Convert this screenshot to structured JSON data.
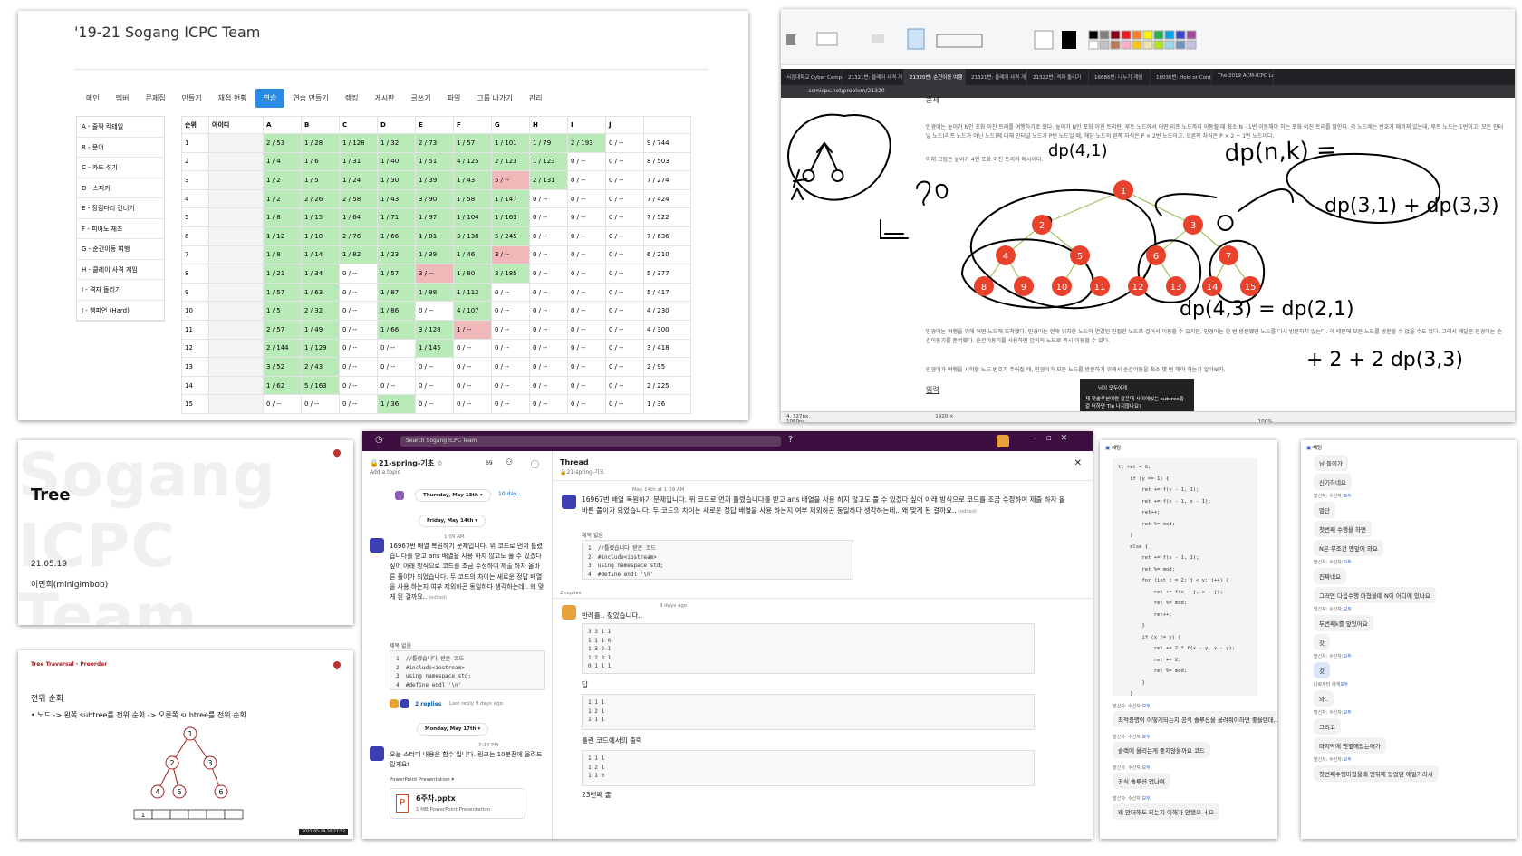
{
  "icpc": {
    "title": "'19-21 Sogang ICPC Team",
    "nav": [
      "메인",
      "멤버",
      "문제집",
      "만들기",
      "채점 현황",
      "연습",
      "연습 만들기",
      "랭킹",
      "게시판",
      "글쓰기",
      "파일",
      "그룹 나가기",
      "관리"
    ],
    "problems": [
      "A - 줄짝 칵테일",
      "B - 문어",
      "C - 카드 섞기",
      "D - 스피카",
      "E - 징검다리 건너기",
      "F - 피아노 체조",
      "G - 순간이동 여행",
      "H - 클레이 사격 게임",
      "I - 격자 돌리기",
      "J - 챔피언 (Hard)"
    ],
    "headers": [
      "순위",
      "아이디",
      "A",
      "B",
      "C",
      "D",
      "E",
      "F",
      "G",
      "H",
      "I",
      "J",
      ""
    ],
    "rows": [
      [
        "1",
        "2 / 53",
        "1 / 28",
        "1 / 128",
        "1 / 32",
        "2 / 73",
        "1 / 57",
        "1 / 101",
        "1 / 79",
        "2 / 193",
        "0 / --",
        "9 / 744"
      ],
      [
        "2",
        "1 / 4",
        "1 / 6",
        "1 / 31",
        "1 / 40",
        "1 / 51",
        "4 / 125",
        "2 / 123",
        "1 / 123",
        "0 / --",
        "0 / --",
        "8 / 503"
      ],
      [
        "3",
        "1 / 2",
        "1 / 5",
        "1 / 24",
        "1 / 30",
        "1 / 39",
        "1 / 43",
        "5 / --",
        "2 / 131",
        "0 / --",
        "0 / --",
        "7 / 274"
      ],
      [
        "4",
        "1 / 2",
        "2 / 26",
        "2 / 58",
        "1 / 43",
        "3 / 90",
        "1 / 58",
        "1 / 147",
        "0 / --",
        "0 / --",
        "0 / --",
        "7 / 424"
      ],
      [
        "5",
        "1 / 8",
        "1 / 15",
        "1 / 64",
        "1 / 71",
        "1 / 97",
        "1 / 104",
        "1 / 163",
        "0 / --",
        "0 / --",
        "0 / --",
        "7 / 522"
      ],
      [
        "6",
        "1 / 12",
        "1 / 18",
        "2 / 76",
        "1 / 66",
        "1 / 81",
        "3 / 138",
        "5 / 245",
        "0 / --",
        "0 / --",
        "0 / --",
        "7 / 636"
      ],
      [
        "7",
        "1 / 8",
        "1 / 14",
        "1 / 82",
        "1 / 23",
        "1 / 39",
        "1 / 46",
        "3 / --",
        "0 / --",
        "0 / --",
        "0 / --",
        "6 / 210"
      ],
      [
        "8",
        "1 / 21",
        "1 / 34",
        "0 / --",
        "1 / 57",
        "3 / --",
        "1 / 80",
        "3 / 185",
        "0 / --",
        "0 / --",
        "0 / --",
        "5 / 377"
      ],
      [
        "9",
        "1 / 57",
        "1 / 63",
        "0 / --",
        "1 / 87",
        "1 / 98",
        "1 / 112",
        "0 / --",
        "0 / --",
        "0 / --",
        "0 / --",
        "5 / 417"
      ],
      [
        "10",
        "1 / 5",
        "2 / 32",
        "0 / --",
        "1 / 86",
        "0 / --",
        "4 / 107",
        "0 / --",
        "0 / --",
        "0 / --",
        "0 / --",
        "4 / 230"
      ],
      [
        "11",
        "2 / 57",
        "1 / 49",
        "0 / --",
        "1 / 66",
        "3 / 128",
        "1 / --",
        "0 / --",
        "0 / --",
        "0 / --",
        "0 / --",
        "4 / 300"
      ],
      [
        "12",
        "2 / 144",
        "1 / 129",
        "0 / --",
        "0 / --",
        "1 / 145",
        "0 / --",
        "0 / --",
        "0 / --",
        "0 / --",
        "0 / --",
        "3 / 418"
      ],
      [
        "13",
        "3 / 52",
        "2 / 43",
        "0 / --",
        "0 / --",
        "0 / --",
        "0 / --",
        "0 / --",
        "0 / --",
        "0 / --",
        "0 / --",
        "2 / 95"
      ],
      [
        "14",
        "1 / 62",
        "5 / 163",
        "0 / --",
        "0 / --",
        "0 / --",
        "0 / --",
        "0 / --",
        "0 / --",
        "0 / --",
        "0 / --",
        "2 / 225"
      ],
      [
        "15",
        "0 / --",
        "0 / --",
        "0 / --",
        "1 / 36",
        "0 / --",
        "0 / --",
        "0 / --",
        "0 / --",
        "0 / --",
        "0 / --",
        "1 / 36"
      ]
    ],
    "colors": {
      "solved": "#b9ebb9",
      "wrong": "#f0b8b8",
      "active_tab": "#2b8ae2"
    }
  },
  "board": {
    "tabs": [
      "서강대학교 Cyber Camp",
      "21321번: 클레이 사격 게",
      "21320번: 순간이동 여행",
      "21321번: 클레이 사격 게",
      "21322번: 격자 돌리기",
      "16686번: 나누기 게임",
      "18036번: Hold or Contin",
      "The 2019 ACM-ICPC Lati"
    ],
    "url": "acmicpc.net/problem/21320",
    "section_title": "문제",
    "para1": "민경이는 높이가 N인 포화 이진 트리를 여행하기로 했다. 높이가 N인 포화 이진 트리란, 루트 노드에서 어떤 리프 노드까지 이동할 때 최소 N - 1번 이동해야 하는 포화 이진 트리를 말한다. 각 노드에는 번호가 매겨져 있는데, 루트 노드는 1번이고, 모든 인터널 노드(리프 노드가 아닌 노드)에 대해 인터널 노드가 P번 노드일 때, 해당 노드의 왼쪽 자식은 P × 2번 노드이고, 오른쪽 자식은 P × 2 + 1번 노드이다.",
    "para2": "아래 그림은 높이가 4인 포화 이진 트리의 예시이다.",
    "para3": "민경이는 여행을 위해 어떤 노드에 도착했다. 민경이는 현재 위치한 노드와 연결된 인접한 노드로 걸어서 이동할 수 있지만, 민경이는 한 번 방문했던 노드를 다시 방문하지 않는다. 이 때문에 모든 노드를 방문할 수 없을 수도 있다. 그래서 깨달은 민경이는 순간이동기를 준비했다. 순간이동기를 사용하면 임의의 노드로 즉시 이동할 수 있다.",
    "para4": "민경이가 여행을 시작할 노드 번호가 주어질 때, 민경이가 모든 노드를 방문하기 위해서 순간이동을 최소 몇 번 해야 하는지 알아보자.",
    "input_title": "입력",
    "equations": [
      "dp(4,1)",
      "dp(n,k) =",
      "dp(3,1) + dp(3,3)",
      "dp(4,3) = dp(2,1)",
      "+ 2 + 2 dp(3,3)"
    ],
    "nodes": [
      "1",
      "2",
      "3",
      "4",
      "5",
      "6",
      "7",
      "8",
      "9",
      "10",
      "11",
      "12",
      "13",
      "14",
      "15"
    ],
    "toast": "제 첫솔루션이랑 같은데 사이에있는 subtree들 갈 더하면 Tle 나지않나요?",
    "toast_title": "님이 모두에게",
    "status": [
      "4, 327px",
      "1920 × 1080px",
      "100%"
    ],
    "node_color": "#e8412c"
  },
  "tree_slide": {
    "bg": "Sogang ICPC Team",
    "title": "Tree",
    "date": "21.05.19",
    "author": "이민희(minigimbob)"
  },
  "preorder": {
    "header": "Tree Traversal - Preorder",
    "subtitle": "전위 순회",
    "bullet": "• 노드 -> 왼쪽 subtree를 전위 순회 -> 오른쪽 subtree를 전위 순회",
    "nodes": [
      "1",
      "2",
      "3",
      "4",
      "5",
      "6"
    ],
    "array_first": "1",
    "stamp": "2021-05-19 20:21:52"
  },
  "slack": {
    "search": "Search Sogang ICPC Team",
    "channel": "🔒21-spring-기초 ☆",
    "topic": "Add a topic",
    "members": "69",
    "date1": "Thursday, May 13th",
    "date2": "Friday, May 14th",
    "date3": "Monday, May 17th",
    "reply_teaser": "10 day...",
    "time1": "1:09 AM",
    "msg1": "16967번 배열 복원하기 문제입니다. 위 코드로 먼저 틀렸습니다를 받고 ans 배열을 사용 하지 않고도 풀 수 있겠다 싶어 아래 방식으로 코드를 조금 수정하여 제출 하자 올바른 풀이가 되었습니다. 두 코드의 차이는 새로운 정답 배열을 사용 하는지 여부 제외하곤 동일하다 생각하는데.. 왜 맞게 된 걸까요..",
    "edited": "(edited)",
    "snip_title": "제목 없음",
    "code": "1  //틀렸습니다 받은 코드\n2  #include<iostream>\n3  using namespace std;\n4  #define endl '\\n'",
    "replies": "2 replies",
    "last_reply": "Last reply 9 days ago",
    "time2": "7:34 PM",
    "msg2": "오늘 스터디 내용은 함수 입니다. 링크는 10분전에 올려드릴게요!",
    "ppt_label": "PowerPoint Presentation",
    "file_name": "6주차.pptx",
    "file_meta": "1 MB PowerPoint Presentation",
    "thread_title": "Thread",
    "thread_channel": "🔒21-spring-기초",
    "thread_date": "May 14th at 1:09 AM",
    "thread_msg": "16967번 배열 복원하기 문제입니다. 위 코드로 먼저 틀렸습니다를 받고 ans 배열을 사용 하지 않고도 풀 수 있겠다 싶어 아래 방식으로 코드를 조금 수정하여 제출 하자 올바른 풀이가 되었습니다. 두 코드의 차이는 새로운 정답 배열을 사용 하는지 여부 제외하곤 동일하다 생각하는데.. 왜 맞게 된 걸까요..",
    "thread_replies": "2 replies",
    "reply_time": "9 days ago",
    "reply_msg": "반례를.. 찾았습니다..",
    "block1": "3 3 1 1\n1 1 1 0\n1 3 2 1\n1 2 3 1\n0 1 1 1",
    "answer_label": "답",
    "block2": "1 1 1\n1 2 1\n1 1 1",
    "wrong_label": "틀린 코드에서의 출력",
    "block3": "1 1 1\n1 2 1\n1 1 0",
    "line23": "23번째 줄"
  },
  "chat1": {
    "header": "채팅",
    "code": "ll ret = 0;\n    if (y == 1) {\n        ret += f(x - 1, 1);\n        ret += f(x - 1, x - 1);\n        ret++;\n        ret %= mod;\n    }\n    else {\n        ret += f(x - 1, 1);\n        ret %= mod;\n        for (int j = 2; j < y; j++) {\n            ret += f(x - j, x - j);\n            ret %= mod;\n            ret++;\n        }\n        if (x != y) {\n            ret += 2 * f(x - y, x - y);\n            ret += 2;\n            ret %= mod;\n        }\n    }",
    "from": "발신자:",
    "to": "수신자:",
    "to_name": "모두",
    "msgs": [
      "최적증명이 어떻게되는지 공식 솔루션을 올려줘야하면 좋을텐데..",
      "슬랙에 올리는게 좋지않을까요 코드",
      "공식 솔루션 없나여",
      "왜 안더해도 되는지 이해가 안됐오 ㅓ요"
    ]
  },
  "chat2": {
    "header": "채팅",
    "from": "발신자:",
    "to": "수신자:",
    "to_name": "모두",
    "private": "나로부터 에게",
    "msgs": [
      "님 들이가",
      "신기하네요",
      "멀단",
      "첫번째 수행을 하면",
      "N은 무조건 맨앞에 와요",
      "진짜네요",
      "그러면 다음수행 마쳤을때 N이 어디에 있나요",
      "두번째k를 앞있어요",
      "갓",
      "갓",
      "와..",
      "그리고",
      "마지막에 맨앞에있는애가",
      "첫번째수행마쳤을때 맨뒤에 있었던 애일거라서"
    ]
  }
}
